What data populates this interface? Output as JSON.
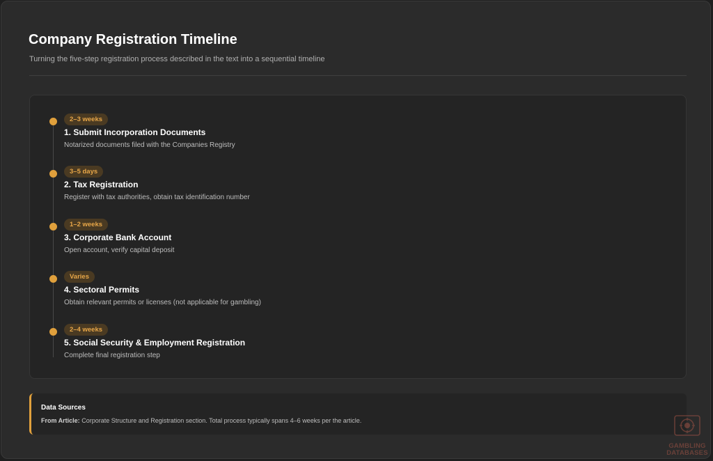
{
  "header": {
    "title": "Company Registration Timeline",
    "subtitle": "Turning the five-step registration process described in the text into a sequential timeline"
  },
  "timeline": {
    "steps": [
      {
        "duration": "2–3 weeks",
        "title": "1. Submit Incorporation Documents",
        "description": "Notarized documents filed with the Companies Registry"
      },
      {
        "duration": "3–5 days",
        "title": "2. Tax Registration",
        "description": "Register with tax authorities, obtain tax identification number"
      },
      {
        "duration": "1–2 weeks",
        "title": "3. Corporate Bank Account",
        "description": "Open account, verify capital deposit"
      },
      {
        "duration": "Varies",
        "title": "4. Sectoral Permits",
        "description": "Obtain relevant permits or licenses (not applicable for gambling)"
      },
      {
        "duration": "2–4 weeks",
        "title": "5. Social Security & Employment Registration",
        "description": "Complete final registration step"
      }
    ]
  },
  "sources": {
    "title": "Data Sources",
    "label": "From Article:",
    "text": " Corporate Structure and Registration section. Total process typically spans 4–6 weeks per the article."
  },
  "watermark": {
    "line1": "GAMBLING",
    "line2": "DATABASES"
  },
  "colors": {
    "accent": "#e0a03c",
    "background": "#2b2b2b",
    "card": "#242424"
  }
}
